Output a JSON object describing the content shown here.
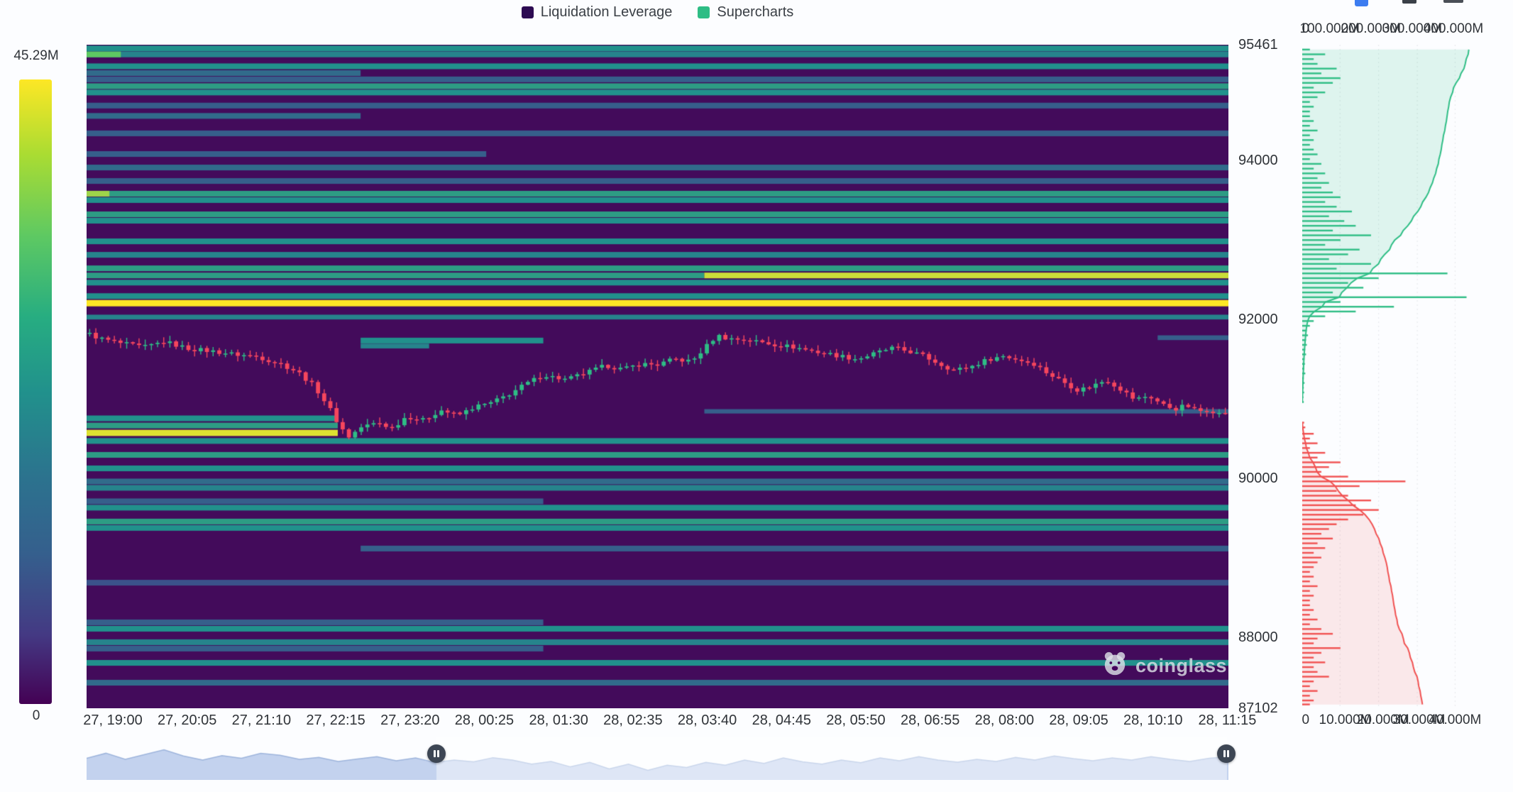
{
  "legend": {
    "items": [
      {
        "label": "Liquidation Leverage",
        "color": "#2d0b52"
      },
      {
        "label": "Supercharts",
        "color": "#2ebd85"
      }
    ]
  },
  "colorbar": {
    "top_label": "45.29M",
    "bottom_label": "0"
  },
  "watermark": {
    "text": "coinglass"
  },
  "axes": {
    "price_ticks": [
      "95461",
      "94000",
      "92000",
      "90000",
      "88000",
      "87102"
    ],
    "price_tick_values": [
      95461,
      94000,
      92000,
      90000,
      88000,
      87102
    ],
    "time_ticks": [
      "27, 19:00",
      "27, 20:05",
      "27, 21:10",
      "27, 22:15",
      "27, 23:20",
      "28, 00:25",
      "28, 01:30",
      "28, 02:35",
      "28, 03:40",
      "28, 04:45",
      "28, 05:50",
      "28, 06:55",
      "28, 08:00",
      "28, 09:05",
      "28, 10:10",
      "28, 11:15"
    ],
    "depth_top_ticks": [
      "0",
      "100.000M",
      "200.000M",
      "300.000M",
      "400.000M"
    ],
    "depth_bottom_ticks": [
      "0",
      "10.000M",
      "20.000M",
      "30.000M",
      "40.000M"
    ]
  },
  "chart_data": [
    {
      "type": "heatmap",
      "name": "liquidation-leverage-heatmap",
      "title": "Liquidation Leverage",
      "price_min": 87102,
      "price_max": 95461,
      "colorbar_max_label": "45.29M",
      "colorbar_min_label": "0",
      "band_columns": [
        "price_top",
        "intensity_0to1",
        "x0_frac",
        "x1_frac",
        "height_price_optional"
      ],
      "bands": [
        [
          95450,
          0.5,
          0,
          1
        ],
        [
          95375,
          0.45,
          0,
          1
        ],
        [
          95375,
          0.75,
          0,
          0.03
        ],
        [
          95225,
          0.5,
          0,
          1
        ],
        [
          95140,
          0.35,
          0,
          0.24
        ],
        [
          95060,
          0.3,
          0,
          1
        ],
        [
          94975,
          0.55,
          0,
          1
        ],
        [
          94895,
          0.5,
          0,
          1
        ],
        [
          94730,
          0.3,
          0,
          1
        ],
        [
          94600,
          0.35,
          0,
          0.24
        ],
        [
          94380,
          0.3,
          0,
          1
        ],
        [
          94120,
          0.3,
          0,
          0.35
        ],
        [
          93950,
          0.35,
          0,
          1
        ],
        [
          93780,
          0.3,
          0,
          1
        ],
        [
          93620,
          0.55,
          0,
          1
        ],
        [
          93620,
          0.85,
          0,
          0.02
        ],
        [
          93540,
          0.5,
          0,
          1
        ],
        [
          93360,
          0.55,
          0,
          1
        ],
        [
          93280,
          0.5,
          0,
          1
        ],
        [
          93020,
          0.5,
          0,
          1
        ],
        [
          92850,
          0.45,
          0,
          1
        ],
        [
          92680,
          0.55,
          0,
          1
        ],
        [
          92590,
          0.55,
          0,
          0.541
        ],
        [
          92590,
          0.92,
          0.541,
          1
        ],
        [
          92500,
          0.5,
          0,
          1
        ],
        [
          92330,
          0.5,
          0,
          1
        ],
        [
          92245,
          1.0,
          0,
          1,
          80
        ],
        [
          92060,
          0.45,
          0,
          1,
          60
        ],
        [
          91800,
          0.3,
          0.938,
          1,
          60
        ],
        [
          91770,
          0.5,
          0.24,
          0.4
        ],
        [
          91695,
          0.45,
          0.24,
          0.3,
          60
        ],
        [
          90870,
          0.3,
          0.541,
          1,
          55
        ],
        [
          90790,
          0.5,
          0,
          0.22
        ],
        [
          90700,
          0.55,
          0,
          0.22
        ],
        [
          90610,
          0.95,
          0,
          0.22,
          78
        ],
        [
          90505,
          0.5,
          0,
          1
        ],
        [
          90330,
          0.55,
          0,
          1
        ],
        [
          90160,
          0.5,
          0,
          1
        ],
        [
          89995,
          0.35,
          0,
          1
        ],
        [
          89915,
          0.45,
          0,
          1
        ],
        [
          89745,
          0.3,
          0,
          0.4
        ],
        [
          89665,
          0.5,
          0,
          1
        ],
        [
          89490,
          0.55,
          0,
          1
        ],
        [
          89410,
          0.5,
          0,
          1
        ],
        [
          89150,
          0.3,
          0.24,
          1
        ],
        [
          88720,
          0.25,
          0,
          1
        ],
        [
          88220,
          0.3,
          0,
          0.4
        ],
        [
          88140,
          0.5,
          0,
          1
        ],
        [
          87970,
          0.45,
          0,
          1
        ],
        [
          87890,
          0.3,
          0,
          0.4
        ],
        [
          87710,
          0.5,
          0,
          1
        ],
        [
          87460,
          0.35,
          0,
          1
        ]
      ]
    },
    {
      "type": "candlestick",
      "name": "btc-price",
      "up_color": "#2ebd85",
      "down_color": "#f6465d",
      "num_candles": 185,
      "path_columns": [
        "x_frac",
        "price"
      ],
      "path": [
        [
          0,
          91830
        ],
        [
          0.012,
          91760
        ],
        [
          0.03,
          91700
        ],
        [
          0.05,
          91650
        ],
        [
          0.068,
          91720
        ],
        [
          0.09,
          91630
        ],
        [
          0.11,
          91600
        ],
        [
          0.13,
          91560
        ],
        [
          0.15,
          91530
        ],
        [
          0.17,
          91440
        ],
        [
          0.185,
          91340
        ],
        [
          0.2,
          91150
        ],
        [
          0.212,
          90900
        ],
        [
          0.222,
          90650
        ],
        [
          0.23,
          90520
        ],
        [
          0.24,
          90640
        ],
        [
          0.255,
          90700
        ],
        [
          0.268,
          90630
        ],
        [
          0.28,
          90780
        ],
        [
          0.295,
          90730
        ],
        [
          0.31,
          90860
        ],
        [
          0.325,
          90790
        ],
        [
          0.34,
          90900
        ],
        [
          0.355,
          90950
        ],
        [
          0.37,
          91060
        ],
        [
          0.385,
          91190
        ],
        [
          0.4,
          91300
        ],
        [
          0.42,
          91240
        ],
        [
          0.44,
          91340
        ],
        [
          0.455,
          91420
        ],
        [
          0.47,
          91370
        ],
        [
          0.485,
          91440
        ],
        [
          0.5,
          91430
        ],
        [
          0.515,
          91500
        ],
        [
          0.53,
          91470
        ],
        [
          0.542,
          91650
        ],
        [
          0.552,
          91800
        ],
        [
          0.562,
          91760
        ],
        [
          0.58,
          91740
        ],
        [
          0.6,
          91690
        ],
        [
          0.62,
          91650
        ],
        [
          0.64,
          91590
        ],
        [
          0.66,
          91540
        ],
        [
          0.675,
          91500
        ],
        [
          0.69,
          91570
        ],
        [
          0.705,
          91640
        ],
        [
          0.72,
          91600
        ],
        [
          0.733,
          91540
        ],
        [
          0.747,
          91440
        ],
        [
          0.76,
          91360
        ],
        [
          0.775,
          91410
        ],
        [
          0.79,
          91500
        ],
        [
          0.803,
          91540
        ],
        [
          0.817,
          91490
        ],
        [
          0.83,
          91440
        ],
        [
          0.843,
          91310
        ],
        [
          0.856,
          91210
        ],
        [
          0.868,
          91110
        ],
        [
          0.88,
          91160
        ],
        [
          0.893,
          91240
        ],
        [
          0.906,
          91120
        ],
        [
          0.918,
          90990
        ],
        [
          0.93,
          91040
        ],
        [
          0.942,
          90930
        ],
        [
          0.953,
          90870
        ],
        [
          0.963,
          90920
        ],
        [
          0.973,
          90840
        ],
        [
          0.983,
          90870
        ],
        [
          0.992,
          90810
        ],
        [
          1,
          90820
        ]
      ]
    },
    {
      "type": "depth",
      "name": "order-book-depth",
      "asks_color": "#2ebd85",
      "bids_color": "#f05151",
      "size_axis_ticks": [
        "0",
        "10.000M",
        "20.000M",
        "30.000M",
        "40.000M"
      ],
      "cumulative_axis_ticks": [
        "0",
        "100.000M",
        "200.000M",
        "300.000M",
        "400.000M"
      ],
      "asks_columns": [
        "price",
        "size_millions"
      ],
      "asks": [
        [
          90960,
          0.4
        ],
        [
          91020,
          0.3
        ],
        [
          91080,
          0.5
        ],
        [
          91140,
          0.4
        ],
        [
          91200,
          0.6
        ],
        [
          91260,
          0.4
        ],
        [
          91320,
          0.8
        ],
        [
          91380,
          0.5
        ],
        [
          91440,
          0.7
        ],
        [
          91500,
          0.6
        ],
        [
          91560,
          1.0
        ],
        [
          91620,
          0.8
        ],
        [
          91680,
          1.2
        ],
        [
          91740,
          1.0
        ],
        [
          91800,
          1.5
        ],
        [
          91860,
          1.2
        ],
        [
          91920,
          2
        ],
        [
          91980,
          3
        ],
        [
          92040,
          6
        ],
        [
          92100,
          14
        ],
        [
          92160,
          24
        ],
        [
          92220,
          10
        ],
        [
          92280,
          43
        ],
        [
          92340,
          8
        ],
        [
          92400,
          16
        ],
        [
          92460,
          12
        ],
        [
          92520,
          20
        ],
        [
          92580,
          38
        ],
        [
          92640,
          9
        ],
        [
          92700,
          18
        ],
        [
          92760,
          7
        ],
        [
          92820,
          12
        ],
        [
          92880,
          15
        ],
        [
          92940,
          6
        ],
        [
          93000,
          10
        ],
        [
          93060,
          18
        ],
        [
          93120,
          8
        ],
        [
          93180,
          14
        ],
        [
          93240,
          11
        ],
        [
          93300,
          7
        ],
        [
          93360,
          13
        ],
        [
          93420,
          9
        ],
        [
          93480,
          6
        ],
        [
          93540,
          10
        ],
        [
          93600,
          8
        ],
        [
          93660,
          5
        ],
        [
          93720,
          7
        ],
        [
          93780,
          4
        ],
        [
          93840,
          6
        ],
        [
          93900,
          3
        ],
        [
          93960,
          5
        ],
        [
          94020,
          2
        ],
        [
          94080,
          4
        ],
        [
          94140,
          3
        ],
        [
          94200,
          2
        ],
        [
          94260,
          3
        ],
        [
          94320,
          2
        ],
        [
          94380,
          4
        ],
        [
          94440,
          2
        ],
        [
          94500,
          3
        ],
        [
          94560,
          2
        ],
        [
          94620,
          2
        ],
        [
          94680,
          3
        ],
        [
          94740,
          2
        ],
        [
          94800,
          4
        ],
        [
          94860,
          6
        ],
        [
          94920,
          3
        ],
        [
          94980,
          8
        ],
        [
          95040,
          10
        ],
        [
          95100,
          5
        ],
        [
          95160,
          9
        ],
        [
          95220,
          4
        ],
        [
          95280,
          3
        ],
        [
          95340,
          6
        ],
        [
          95400,
          2
        ]
      ],
      "bids_columns": [
        "price",
        "size_millions"
      ],
      "bids": [
        [
          90700,
          0.5
        ],
        [
          90640,
          0.8
        ],
        [
          90560,
          3
        ],
        [
          90500,
          2
        ],
        [
          90440,
          4
        ],
        [
          90380,
          2
        ],
        [
          90320,
          6
        ],
        [
          90260,
          4
        ],
        [
          90200,
          10
        ],
        [
          90140,
          7
        ],
        [
          90080,
          5
        ],
        [
          90020,
          12
        ],
        [
          89960,
          27
        ],
        [
          89900,
          15
        ],
        [
          89840,
          9
        ],
        [
          89780,
          12
        ],
        [
          89720,
          18
        ],
        [
          89660,
          14
        ],
        [
          89600,
          20
        ],
        [
          89540,
          16
        ],
        [
          89480,
          12
        ],
        [
          89420,
          9
        ],
        [
          89360,
          7
        ],
        [
          89300,
          5
        ],
        [
          89240,
          8
        ],
        [
          89180,
          4
        ],
        [
          89120,
          6
        ],
        [
          89060,
          3
        ],
        [
          89000,
          5
        ],
        [
          88940,
          4
        ],
        [
          88880,
          3
        ],
        [
          88820,
          2
        ],
        [
          88760,
          3
        ],
        [
          88700,
          2
        ],
        [
          88640,
          4
        ],
        [
          88580,
          2
        ],
        [
          88520,
          3
        ],
        [
          88460,
          2
        ],
        [
          88400,
          2
        ],
        [
          88340,
          3
        ],
        [
          88280,
          2
        ],
        [
          88220,
          4
        ],
        [
          88160,
          2
        ],
        [
          88100,
          5
        ],
        [
          88040,
          8
        ],
        [
          87980,
          4
        ],
        [
          87920,
          3
        ],
        [
          87860,
          10
        ],
        [
          87800,
          5
        ],
        [
          87740,
          3
        ],
        [
          87680,
          6
        ],
        [
          87620,
          3
        ],
        [
          87560,
          4
        ],
        [
          87500,
          7
        ],
        [
          87440,
          3
        ],
        [
          87380,
          2
        ],
        [
          87320,
          4
        ],
        [
          87260,
          2
        ],
        [
          87200,
          3
        ],
        [
          87150,
          2
        ]
      ]
    },
    {
      "type": "area",
      "name": "navigator-overview",
      "values": [
        0.55,
        0.7,
        0.52,
        0.66,
        0.8,
        0.62,
        0.5,
        0.63,
        0.55,
        0.7,
        0.64,
        0.52,
        0.58,
        0.46,
        0.53,
        0.6,
        0.48,
        0.56,
        0.43,
        0.5,
        0.45,
        0.57,
        0.5,
        0.38,
        0.46,
        0.3,
        0.43,
        0.24,
        0.38,
        0.2,
        0.35,
        0.28,
        0.43,
        0.35,
        0.5,
        0.4,
        0.56,
        0.45,
        0.38,
        0.5,
        0.42,
        0.56,
        0.48,
        0.6,
        0.5,
        0.44,
        0.52,
        0.46,
        0.58,
        0.5,
        0.62,
        0.54,
        0.48,
        0.56,
        0.5,
        0.6,
        0.52,
        0.46,
        0.55,
        0.6
      ]
    }
  ]
}
